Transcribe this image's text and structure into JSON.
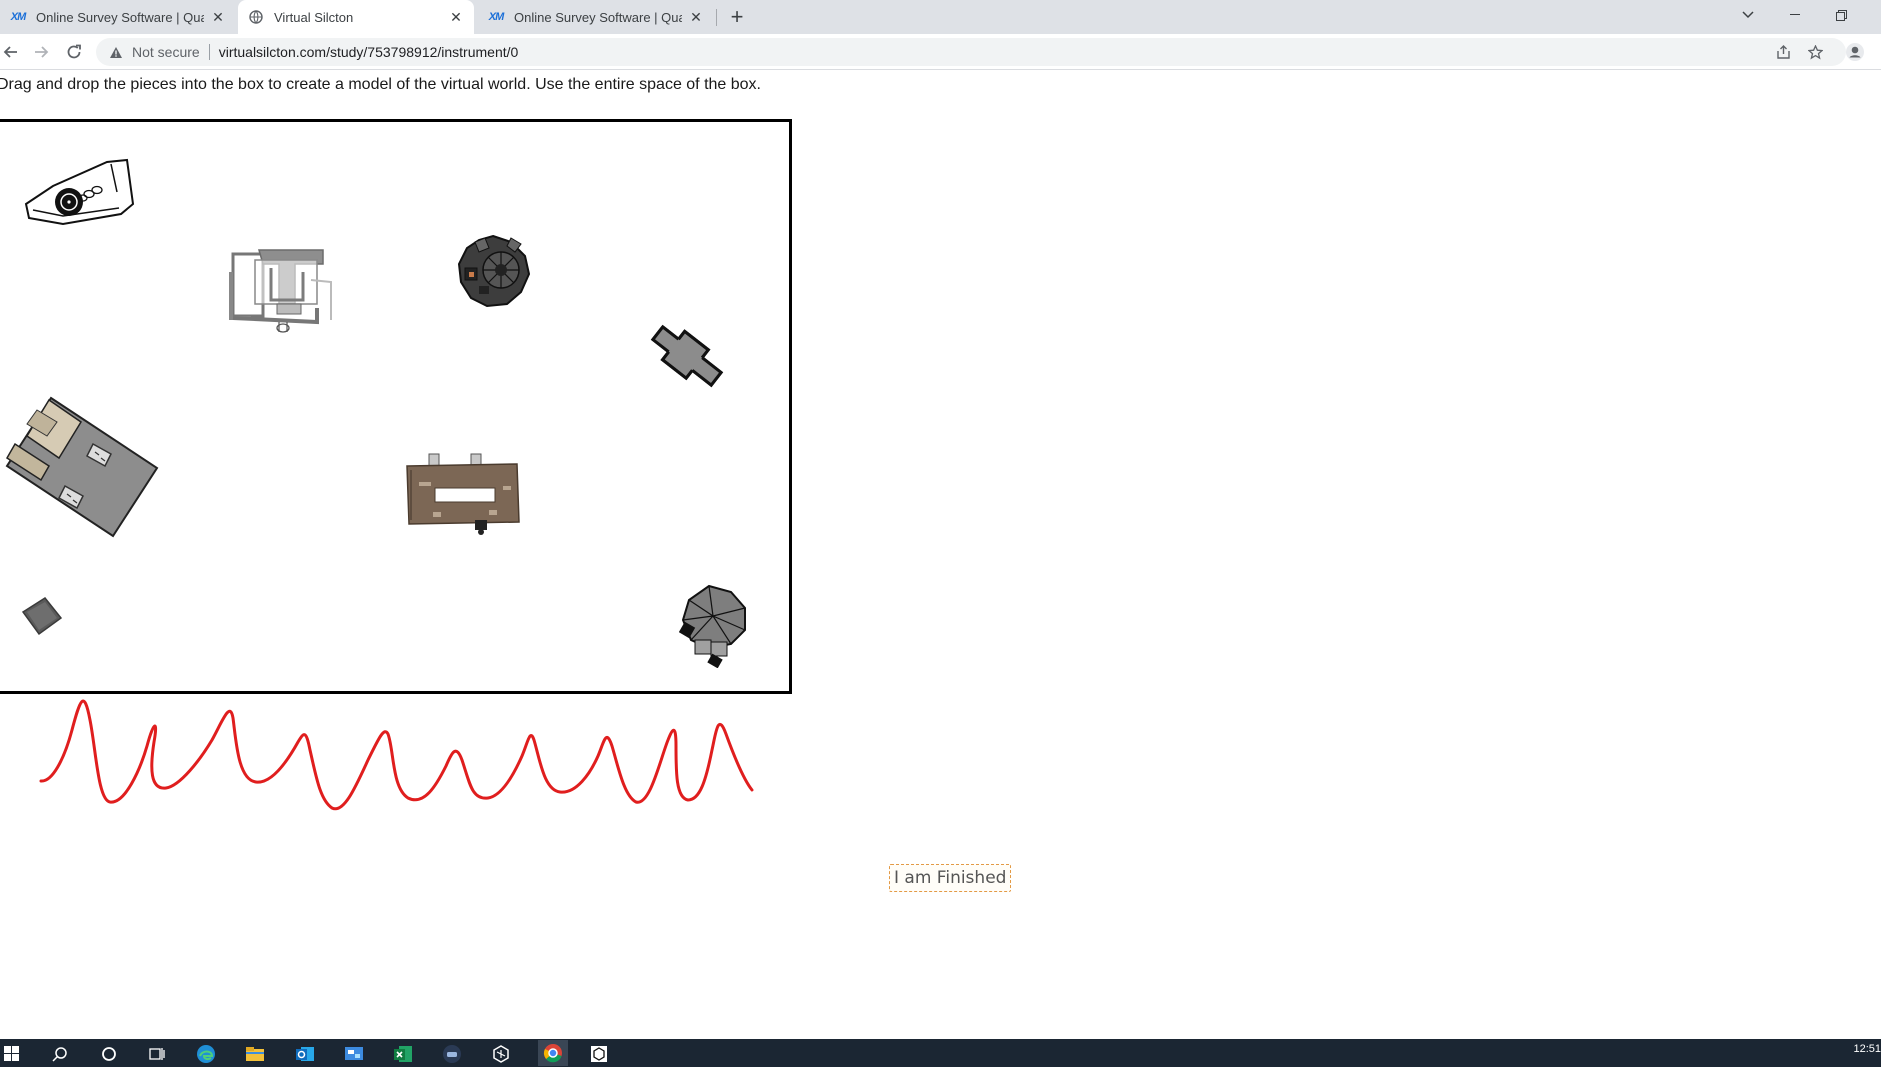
{
  "browser": {
    "tabs": [
      {
        "title": "Online Survey Software | Qualtrics",
        "favicon": "qualtrics-xm-icon",
        "active": false
      },
      {
        "title": "Virtual Silcton",
        "favicon": "globe-icon",
        "active": true
      },
      {
        "title": "Online Survey Software | Qualtrics",
        "favicon": "qualtrics-xm-icon",
        "active": false
      }
    ],
    "favicon_text": "XM",
    "address": {
      "security_label": "Not secure",
      "url": "virtualsilcton.com/study/753798912/instrument/0"
    }
  },
  "page": {
    "instruction": "Drag and drop the pieces into the box to create a model of the virtual world. Use the entire space of the box.",
    "finish_label": "I am Finished",
    "pieces": [
      {
        "name": "piece-stadium"
      },
      {
        "name": "piece-t-building"
      },
      {
        "name": "piece-round-gazebo"
      },
      {
        "name": "piece-cross-building"
      },
      {
        "name": "piece-large-lot"
      },
      {
        "name": "piece-brown-hall"
      },
      {
        "name": "piece-small-shed"
      },
      {
        "name": "piece-octagon-house"
      }
    ]
  },
  "colors": {
    "annotation_stroke": "#e01e1e",
    "finish_border": "#e39a45",
    "taskbar": "#1b2633"
  },
  "taskbar": {
    "clock": "12:51"
  }
}
